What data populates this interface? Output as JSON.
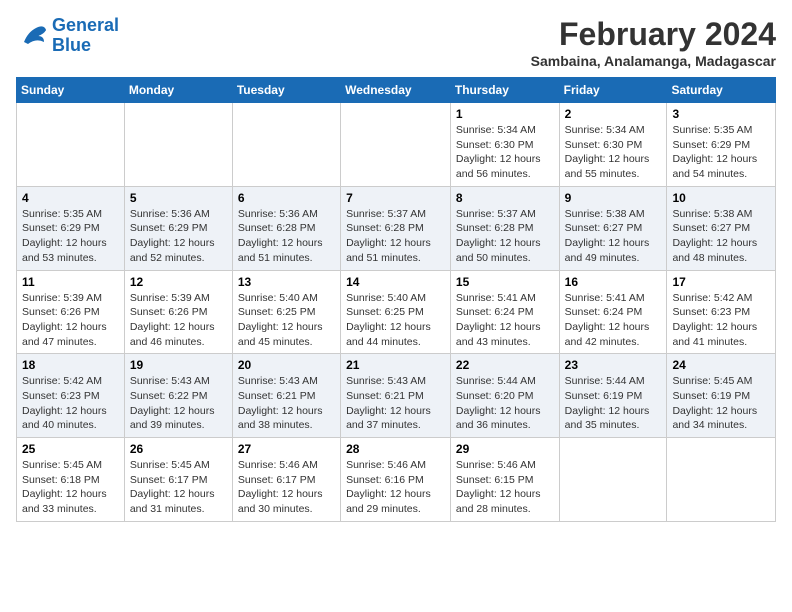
{
  "logo": {
    "text_general": "General",
    "text_blue": "Blue"
  },
  "header": {
    "month_year": "February 2024",
    "location": "Sambaina, Analamanga, Madagascar"
  },
  "weekdays": [
    "Sunday",
    "Monday",
    "Tuesday",
    "Wednesday",
    "Thursday",
    "Friday",
    "Saturday"
  ],
  "weeks": [
    {
      "row_shaded": false,
      "days": [
        {
          "num": "",
          "info": ""
        },
        {
          "num": "",
          "info": ""
        },
        {
          "num": "",
          "info": ""
        },
        {
          "num": "",
          "info": ""
        },
        {
          "num": "1",
          "info": "Sunrise: 5:34 AM\nSunset: 6:30 PM\nDaylight: 12 hours\nand 56 minutes."
        },
        {
          "num": "2",
          "info": "Sunrise: 5:34 AM\nSunset: 6:30 PM\nDaylight: 12 hours\nand 55 minutes."
        },
        {
          "num": "3",
          "info": "Sunrise: 5:35 AM\nSunset: 6:29 PM\nDaylight: 12 hours\nand 54 minutes."
        }
      ]
    },
    {
      "row_shaded": true,
      "days": [
        {
          "num": "4",
          "info": "Sunrise: 5:35 AM\nSunset: 6:29 PM\nDaylight: 12 hours\nand 53 minutes."
        },
        {
          "num": "5",
          "info": "Sunrise: 5:36 AM\nSunset: 6:29 PM\nDaylight: 12 hours\nand 52 minutes."
        },
        {
          "num": "6",
          "info": "Sunrise: 5:36 AM\nSunset: 6:28 PM\nDaylight: 12 hours\nand 51 minutes."
        },
        {
          "num": "7",
          "info": "Sunrise: 5:37 AM\nSunset: 6:28 PM\nDaylight: 12 hours\nand 51 minutes."
        },
        {
          "num": "8",
          "info": "Sunrise: 5:37 AM\nSunset: 6:28 PM\nDaylight: 12 hours\nand 50 minutes."
        },
        {
          "num": "9",
          "info": "Sunrise: 5:38 AM\nSunset: 6:27 PM\nDaylight: 12 hours\nand 49 minutes."
        },
        {
          "num": "10",
          "info": "Sunrise: 5:38 AM\nSunset: 6:27 PM\nDaylight: 12 hours\nand 48 minutes."
        }
      ]
    },
    {
      "row_shaded": false,
      "days": [
        {
          "num": "11",
          "info": "Sunrise: 5:39 AM\nSunset: 6:26 PM\nDaylight: 12 hours\nand 47 minutes."
        },
        {
          "num": "12",
          "info": "Sunrise: 5:39 AM\nSunset: 6:26 PM\nDaylight: 12 hours\nand 46 minutes."
        },
        {
          "num": "13",
          "info": "Sunrise: 5:40 AM\nSunset: 6:25 PM\nDaylight: 12 hours\nand 45 minutes."
        },
        {
          "num": "14",
          "info": "Sunrise: 5:40 AM\nSunset: 6:25 PM\nDaylight: 12 hours\nand 44 minutes."
        },
        {
          "num": "15",
          "info": "Sunrise: 5:41 AM\nSunset: 6:24 PM\nDaylight: 12 hours\nand 43 minutes."
        },
        {
          "num": "16",
          "info": "Sunrise: 5:41 AM\nSunset: 6:24 PM\nDaylight: 12 hours\nand 42 minutes."
        },
        {
          "num": "17",
          "info": "Sunrise: 5:42 AM\nSunset: 6:23 PM\nDaylight: 12 hours\nand 41 minutes."
        }
      ]
    },
    {
      "row_shaded": true,
      "days": [
        {
          "num": "18",
          "info": "Sunrise: 5:42 AM\nSunset: 6:23 PM\nDaylight: 12 hours\nand 40 minutes."
        },
        {
          "num": "19",
          "info": "Sunrise: 5:43 AM\nSunset: 6:22 PM\nDaylight: 12 hours\nand 39 minutes."
        },
        {
          "num": "20",
          "info": "Sunrise: 5:43 AM\nSunset: 6:21 PM\nDaylight: 12 hours\nand 38 minutes."
        },
        {
          "num": "21",
          "info": "Sunrise: 5:43 AM\nSunset: 6:21 PM\nDaylight: 12 hours\nand 37 minutes."
        },
        {
          "num": "22",
          "info": "Sunrise: 5:44 AM\nSunset: 6:20 PM\nDaylight: 12 hours\nand 36 minutes."
        },
        {
          "num": "23",
          "info": "Sunrise: 5:44 AM\nSunset: 6:19 PM\nDaylight: 12 hours\nand 35 minutes."
        },
        {
          "num": "24",
          "info": "Sunrise: 5:45 AM\nSunset: 6:19 PM\nDaylight: 12 hours\nand 34 minutes."
        }
      ]
    },
    {
      "row_shaded": false,
      "days": [
        {
          "num": "25",
          "info": "Sunrise: 5:45 AM\nSunset: 6:18 PM\nDaylight: 12 hours\nand 33 minutes."
        },
        {
          "num": "26",
          "info": "Sunrise: 5:45 AM\nSunset: 6:17 PM\nDaylight: 12 hours\nand 31 minutes."
        },
        {
          "num": "27",
          "info": "Sunrise: 5:46 AM\nSunset: 6:17 PM\nDaylight: 12 hours\nand 30 minutes."
        },
        {
          "num": "28",
          "info": "Sunrise: 5:46 AM\nSunset: 6:16 PM\nDaylight: 12 hours\nand 29 minutes."
        },
        {
          "num": "29",
          "info": "Sunrise: 5:46 AM\nSunset: 6:15 PM\nDaylight: 12 hours\nand 28 minutes."
        },
        {
          "num": "",
          "info": ""
        },
        {
          "num": "",
          "info": ""
        }
      ]
    }
  ]
}
